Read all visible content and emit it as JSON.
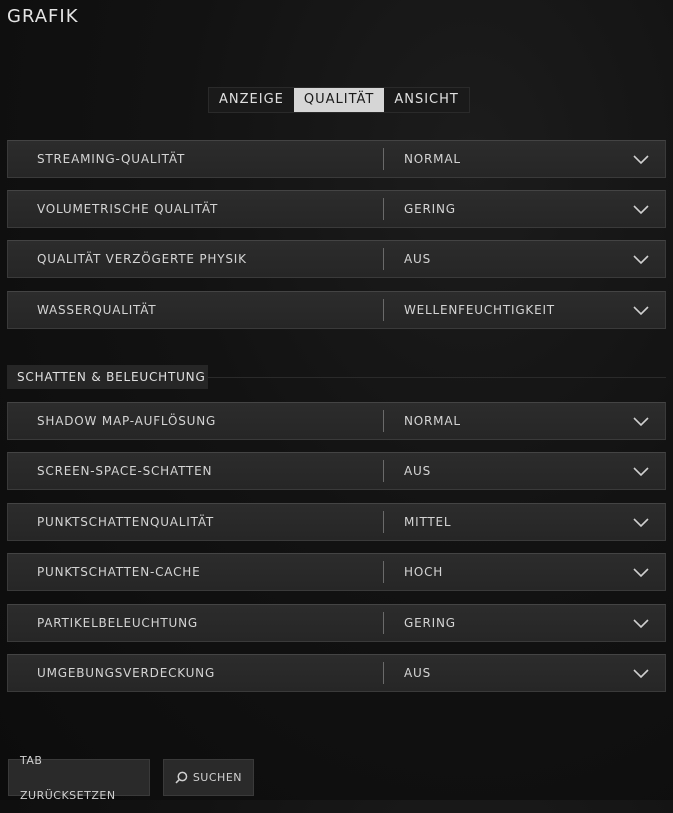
{
  "page": {
    "title": "GRAFIK"
  },
  "tabs": [
    {
      "label": "ANZEIGE",
      "active": false
    },
    {
      "label": "QUALITÄT",
      "active": true
    },
    {
      "label": "ANSICHT",
      "active": false
    }
  ],
  "settings_top": [
    {
      "label": "STREAMING-QUALITÄT",
      "value": "NORMAL"
    },
    {
      "label": "VOLUMETRISCHE QUALITÄT",
      "value": "GERING"
    },
    {
      "label": "QUALITÄT VERZÖGERTE PHYSIK",
      "value": "AUS"
    },
    {
      "label": "WASSERQUALITÄT",
      "value": "WELLENFEUCHTIGKEIT"
    }
  ],
  "section": {
    "title": "SCHATTEN & BELEUCHTUNG"
  },
  "settings_shadow": [
    {
      "label": "SHADOW MAP-AUFLÖSUNG",
      "value": "NORMAL"
    },
    {
      "label": "SCREEN-SPACE-SCHATTEN",
      "value": "AUS"
    },
    {
      "label": "PUNKTSCHATTENQUALITÄT",
      "value": "MITTEL"
    },
    {
      "label": "PUNKTSCHATTEN-CACHE",
      "value": "HOCH"
    },
    {
      "label": "PARTIKELBELEUCHTUNG",
      "value": "GERING"
    },
    {
      "label": "UMGEBUNGSVERDECKUNG",
      "value": "AUS"
    }
  ],
  "footer": {
    "reset_label": "TAB ZURÜCKSETZEN",
    "search_label": "SUCHEN",
    "search_icon": "search-icon"
  },
  "colors": {
    "background": "#121212",
    "row_background": "#2a2a2a",
    "active_tab": "#d6d6d6",
    "text": "#d4d4d4"
  }
}
